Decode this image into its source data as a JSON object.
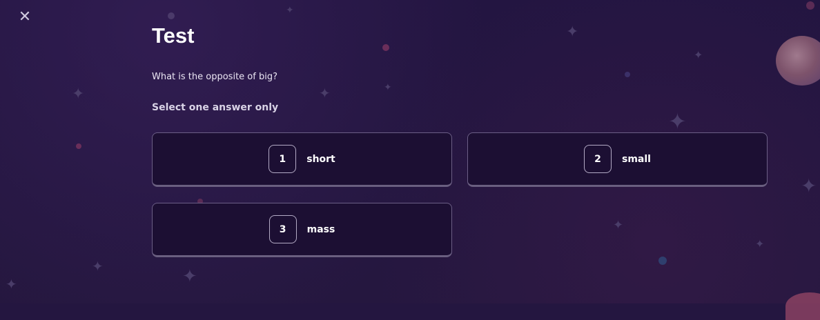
{
  "header": {
    "close_icon": "close-icon"
  },
  "quiz": {
    "title": "Test",
    "question": "What is the opposite of big?",
    "instruction": "Select one answer only",
    "answers": [
      {
        "number": "1",
        "text": "short"
      },
      {
        "number": "2",
        "text": "small"
      },
      {
        "number": "3",
        "text": "mass"
      }
    ]
  },
  "colors": {
    "background": "#241640",
    "card_background": "#1c0f33",
    "card_border": "#6c5f86",
    "text": "#ffffff"
  }
}
